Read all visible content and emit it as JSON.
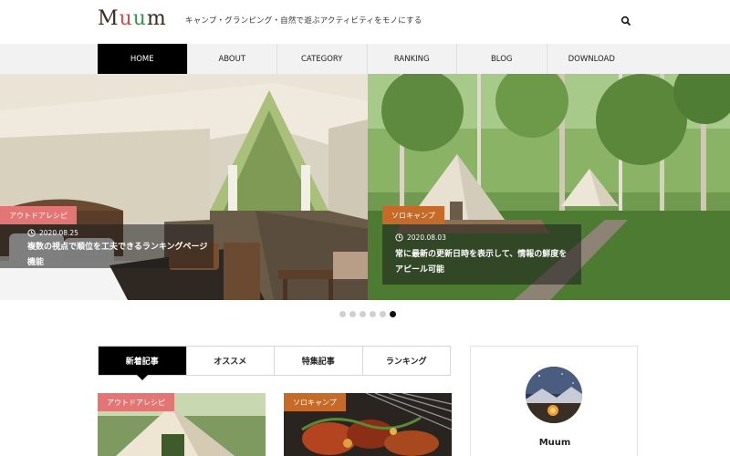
{
  "header": {
    "logo": "Muum",
    "tagline": "キャンプ・グランピング・自然で遊ぶアクティビティをモノにする"
  },
  "nav": {
    "items": [
      {
        "label": "HOME",
        "active": true
      },
      {
        "label": "ABOUT",
        "active": false
      },
      {
        "label": "CATEGORY",
        "active": false
      },
      {
        "label": "RANKING",
        "active": false
      },
      {
        "label": "BLOG",
        "active": false
      },
      {
        "label": "DOWNLOAD",
        "active": false
      }
    ]
  },
  "slider": {
    "slides": [
      {
        "category": "アウトドアレシピ",
        "date": "2020.08.25",
        "title": "複数の視点で順位を工夫できるランキングページ機能"
      },
      {
        "category": "ソロキャンプ",
        "date": "2020.08.03",
        "title": "常に最新の更新日時を表示して、情報の鮮度をアピール可能"
      }
    ],
    "dot_count": 6,
    "active_dot": 6
  },
  "tabs": [
    {
      "label": "新着記事",
      "active": true
    },
    {
      "label": "オススメ",
      "active": false
    },
    {
      "label": "特集記事",
      "active": false
    },
    {
      "label": "ランキング",
      "active": false
    }
  ],
  "cards": [
    {
      "category": "アウトドアレシピ"
    },
    {
      "category": "ソロキャンプ"
    }
  ],
  "profile": {
    "name": "Muum"
  },
  "colors": {
    "accent_pink": "#e37575",
    "accent_orange": "#c66a28",
    "nav_active": "#000000"
  }
}
